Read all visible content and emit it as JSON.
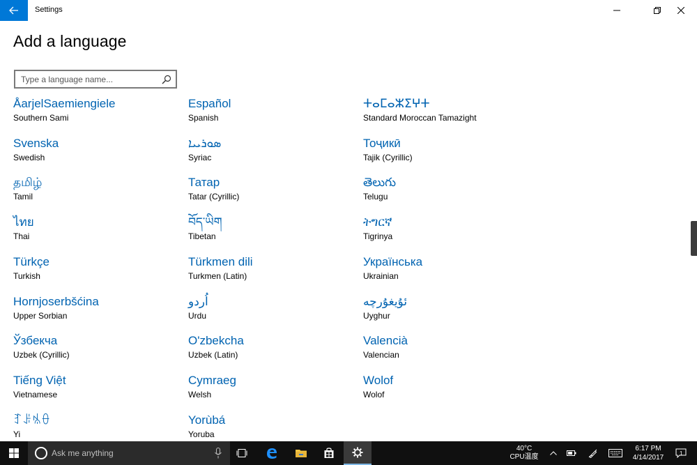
{
  "window": {
    "app_title": "Settings",
    "page_title": "Add a language"
  },
  "search": {
    "placeholder": "Type a language name..."
  },
  "languages": [
    {
      "native": "ÅarjelSaemiengiele",
      "english": "Southern Sami"
    },
    {
      "native": "Español",
      "english": "Spanish"
    },
    {
      "native": "ⵜⴰⵎⴰⵣⵉⵖⵜ",
      "english": "Standard Moroccan Tamazight"
    },
    {
      "native": "Svenska",
      "english": "Swedish"
    },
    {
      "native": "ܣܘܪܝܝܐ",
      "english": "Syriac"
    },
    {
      "native": "Тоҷикӣ",
      "english": "Tajik (Cyrillic)"
    },
    {
      "native": "தமிழ்",
      "english": "Tamil"
    },
    {
      "native": "Татар",
      "english": "Tatar (Cyrillic)"
    },
    {
      "native": "తెలుగు",
      "english": "Telugu"
    },
    {
      "native": "ไทย",
      "english": "Thai"
    },
    {
      "native": "བོད་ཡིག",
      "english": "Tibetan"
    },
    {
      "native": "ትግርኛ",
      "english": "Tigrinya"
    },
    {
      "native": "Türkçe",
      "english": "Turkish"
    },
    {
      "native": "Türkmen dili",
      "english": "Turkmen (Latin)"
    },
    {
      "native": "Українська",
      "english": "Ukrainian"
    },
    {
      "native": "Hornjoserbšćina",
      "english": "Upper Sorbian"
    },
    {
      "native": "اُردو",
      "english": "Urdu"
    },
    {
      "native": "ئۇيغۇرچە",
      "english": "Uyghur"
    },
    {
      "native": "Ўзбекча",
      "english": "Uzbek (Cyrillic)"
    },
    {
      "native": "O'zbekcha",
      "english": "Uzbek (Latin)"
    },
    {
      "native": "Valencià",
      "english": "Valencian"
    },
    {
      "native": "Tiếng Việt",
      "english": "Vietnamese"
    },
    {
      "native": "Cymraeg",
      "english": "Welsh"
    },
    {
      "native": "Wolof",
      "english": "Wolof"
    },
    {
      "native": "ꆈꌠꁱꂷ",
      "english": "Yi"
    },
    {
      "native": "Yorùbá",
      "english": "Yoruba"
    }
  ],
  "taskbar": {
    "search_text": "Ask me anything",
    "cpu_temp": "40°C",
    "cpu_label": "CPU温度",
    "time": "6:17 PM",
    "date": "4/14/2017",
    "notification_count": "1"
  },
  "colors": {
    "accent": "#0078d7",
    "link": "#0063b1",
    "taskbar": "#101010"
  }
}
